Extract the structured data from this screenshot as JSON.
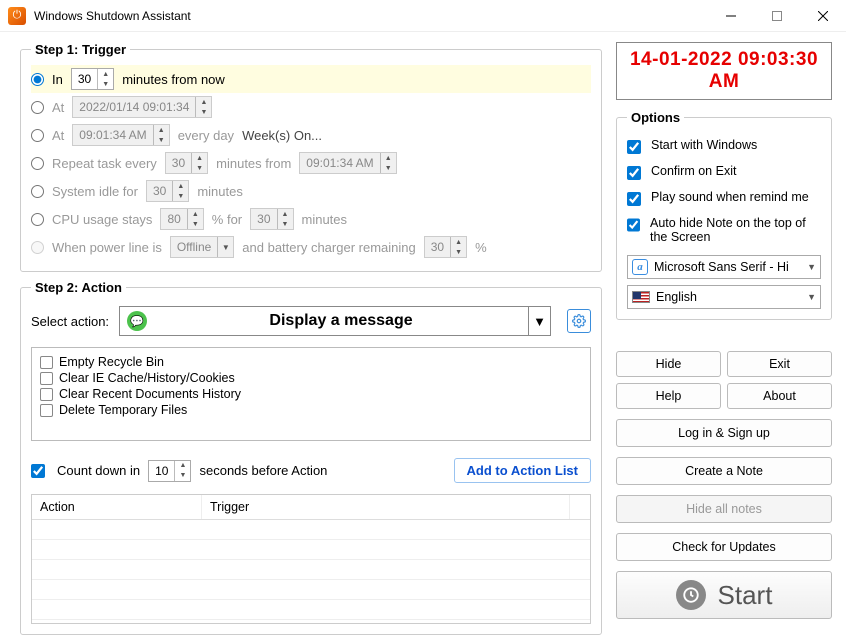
{
  "window": {
    "title": "Windows Shutdown Assistant"
  },
  "step1": {
    "legend": "Step 1: Trigger",
    "in": {
      "label": "In",
      "value": "30",
      "suffix": "minutes from now"
    },
    "at_datetime": {
      "label": "At",
      "value": "2022/01/14 09:01:34"
    },
    "at_time": {
      "label": "At",
      "value": "09:01:34 AM",
      "every": "every day",
      "weeks": "Week(s) On..."
    },
    "repeat": {
      "label": "Repeat task every",
      "value": "30",
      "mid": "minutes from",
      "time": "09:01:34 AM"
    },
    "idle": {
      "label": "System idle for",
      "value": "30",
      "suffix": "minutes"
    },
    "cpu": {
      "label": "CPU usage stays",
      "value": "80",
      "pct": "% for",
      "value2": "30",
      "suffix": "minutes"
    },
    "power": {
      "label": "When power line is",
      "state": "Offline",
      "mid": "and battery charger remaining",
      "value": "30",
      "pct": "%"
    }
  },
  "step2": {
    "legend": "Step 2: Action",
    "select_label": "Select action:",
    "selected_action": "Display a message",
    "extras": [
      "Empty Recycle Bin",
      "Clear IE Cache/History/Cookies",
      "Clear Recent Documents History",
      "Delete Temporary Files"
    ],
    "countdown": {
      "label": "Count down in",
      "value": "10",
      "suffix": "seconds before Action"
    },
    "add_btn": "Add to Action List",
    "table": {
      "col_action": "Action",
      "col_trigger": "Trigger"
    }
  },
  "clock": "14-01-2022 09:03:30 AM",
  "options": {
    "legend": "Options",
    "start_windows": "Start with Windows",
    "confirm_exit": "Confirm on Exit",
    "play_sound": "Play sound when remind me",
    "auto_hide": "Auto hide Note on the top of the Screen"
  },
  "font": "Microsoft Sans Serif    - Hi",
  "language": "English",
  "buttons": {
    "hide": "Hide",
    "exit": "Exit",
    "help": "Help",
    "about": "About",
    "login": "Log in & Sign up",
    "create_note": "Create a Note",
    "hide_all": "Hide all notes",
    "check_updates": "Check for Updates",
    "start": "Start"
  }
}
